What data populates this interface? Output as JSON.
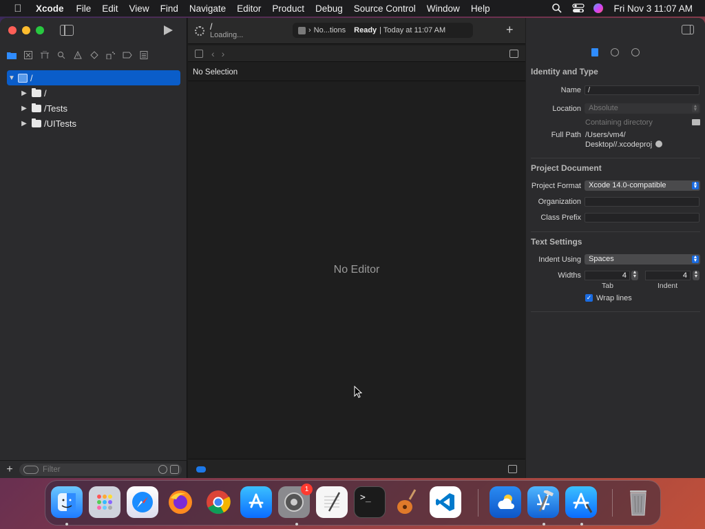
{
  "menubar": {
    "apple": "",
    "app_name": "Xcode",
    "items": [
      "File",
      "Edit",
      "View",
      "Find",
      "Navigate",
      "Editor",
      "Product",
      "Debug",
      "Source Control",
      "Window",
      "Help"
    ],
    "clock": "Fri Nov 3  11:07 AM"
  },
  "toolbar": {
    "scheme_title": "/",
    "scheme_status": "Loading...",
    "activity_target": "No...tions",
    "activity_status": "Ready",
    "activity_time": "| Today at 11:07 AM",
    "add_tab": "+"
  },
  "navigator": {
    "tree": [
      {
        "label": "/",
        "type": "project",
        "expanded": true
      },
      {
        "label": "/",
        "type": "folder"
      },
      {
        "label": "/Tests",
        "type": "folder"
      },
      {
        "label": "/UITests",
        "type": "folder"
      }
    ],
    "filter_placeholder": "Filter",
    "add": "+"
  },
  "editor": {
    "breadcrumb": "No Selection",
    "empty_message": "No Editor"
  },
  "inspector": {
    "identity": {
      "title": "Identity and Type",
      "name_label": "Name",
      "name_value": "/",
      "location_label": "Location",
      "location_value": "Absolute",
      "containing": "Containing directory",
      "full_path_label": "Full Path",
      "full_path_line1": "/Users/vm4/",
      "full_path_line2": "Desktop//.xcodeproj"
    },
    "project_document": {
      "title": "Project Document",
      "format_label": "Project Format",
      "format_value": "Xcode 14.0-compatible",
      "org_label": "Organization",
      "org_value": "",
      "prefix_label": "Class Prefix",
      "prefix_value": ""
    },
    "text_settings": {
      "title": "Text Settings",
      "indent_label": "Indent Using",
      "indent_value": "Spaces",
      "widths_label": "Widths",
      "tab_value": "4",
      "indent_width_value": "4",
      "tab_sub": "Tab",
      "indent_sub": "Indent",
      "wrap_label": "Wrap lines"
    }
  },
  "dock": {
    "badge_settings": "1"
  },
  "colors": {
    "accent": "#0a5dc9",
    "badge": "#ff3b30"
  }
}
